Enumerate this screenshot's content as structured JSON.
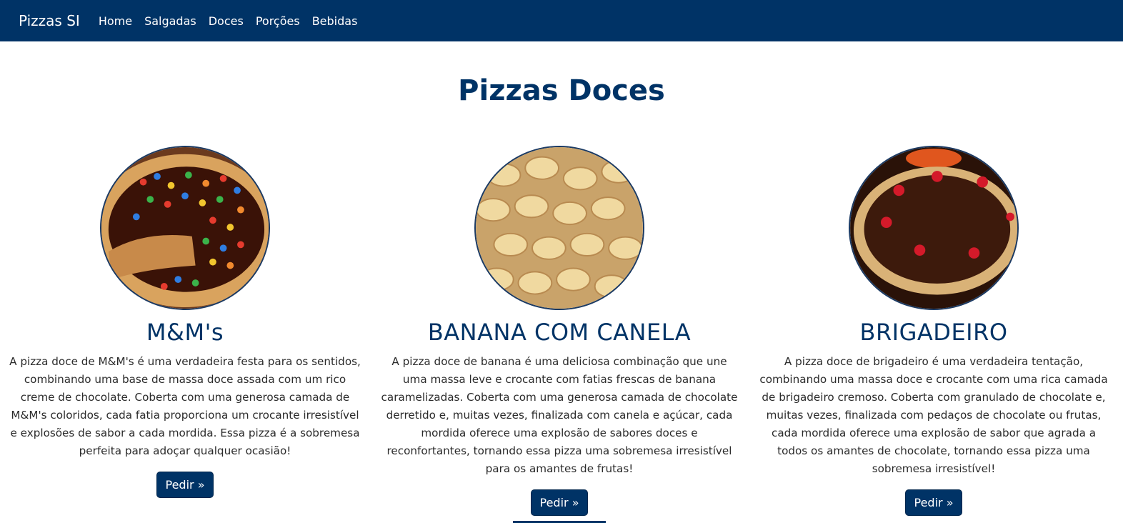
{
  "navbar": {
    "brand": "Pizzas SI",
    "links": [
      "Home",
      "Salgadas",
      "Doces",
      "Porções",
      "Bebidas"
    ]
  },
  "page": {
    "title": "Pizzas Doces"
  },
  "cards": [
    {
      "title": "M&M's",
      "text": "A pizza doce de M&M's é uma verdadeira festa para os sentidos, combinando uma base de massa doce assada com um rico creme de chocolate. Coberta com uma generosa camada de M&M's coloridos, cada fatia proporciona um crocante irresistível e explosões de sabor a cada mordida. Essa pizza é a sobremesa perfeita para adoçar qualquer ocasião!",
      "button": "Pedir »"
    },
    {
      "title": "BANANA COM CANELA",
      "text": "A pizza doce de banana é uma deliciosa combinação que une uma massa leve e crocante com fatias frescas de banana caramelizadas. Coberta com uma generosa camada de chocolate derretido e, muitas vezes, finalizada com canela e açúcar, cada mordida oferece uma explosão de sabores doces e reconfortantes, tornando essa pizza uma sobremesa irresistível para os amantes de frutas!",
      "button": "Pedir »"
    },
    {
      "title": "BRIGADEIRO",
      "text": "A pizza doce de brigadeiro é uma verdadeira tentação, combinando uma massa doce e crocante com uma rica camada de brigadeiro cremoso. Coberta com granulado de chocolate e, muitas vezes, finalizada com pedaços de chocolate ou frutas, cada mordida oferece uma explosão de sabor que agrada a todos os amantes de chocolate, tornando essa pizza uma sobremesa irresistível!",
      "button": "Pedir »"
    }
  ],
  "colors": {
    "primary": "#003366",
    "white": "#ffffff"
  }
}
